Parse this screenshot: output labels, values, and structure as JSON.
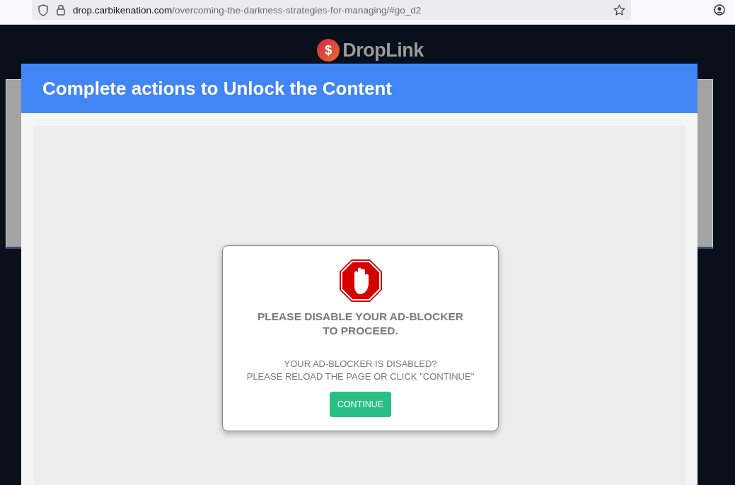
{
  "browser": {
    "url_host": "drop.carbikenation.com",
    "url_path": "/overcoming-the-darkness-strategies-for-managing/#go_d2"
  },
  "logo": {
    "mark": "$",
    "name": "DropLink"
  },
  "modal": {
    "title": "Complete actions to Unlock the Content",
    "dialog": {
      "heading": "PLEASE DISABLE YOUR AD-BLOCKER TO PROCEED.",
      "message_lines": [
        "YOUR AD-BLOCKER IS DISABLED?",
        "PLEASE RELOAD THE PAGE OR CLICK \"CONTINUE\""
      ],
      "button": "CONTINUE"
    }
  }
}
